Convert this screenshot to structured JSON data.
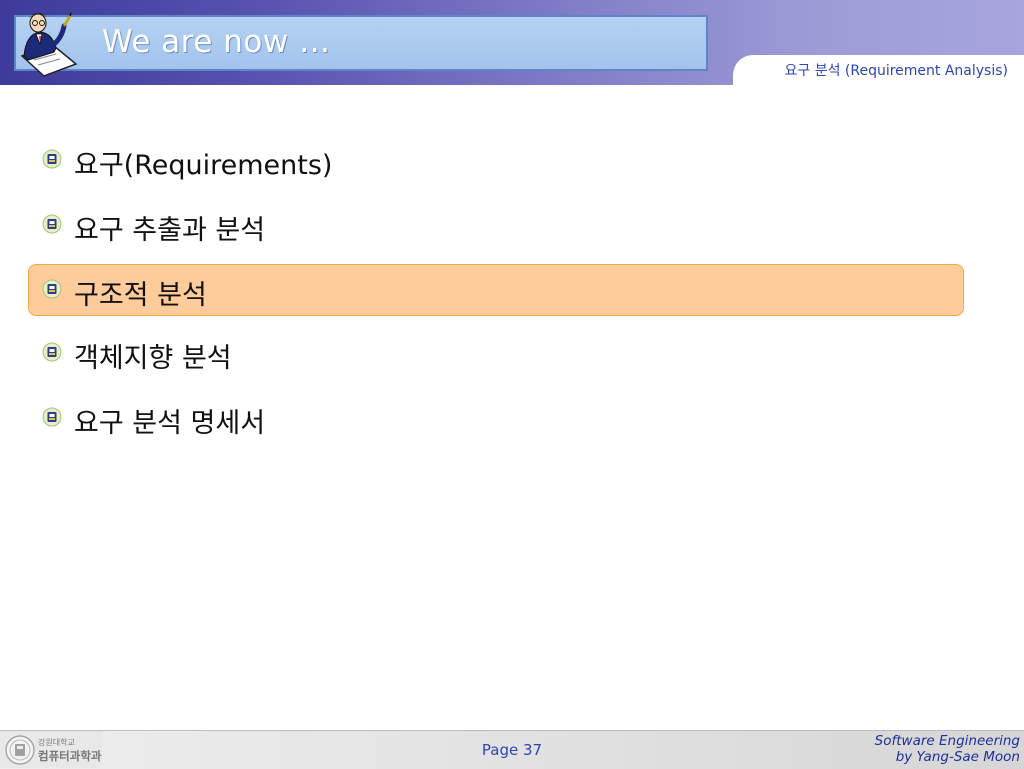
{
  "header": {
    "title": "We are now …",
    "section": "요구 분석 (Requirement Analysis)",
    "logo_icon": "teacher-writing-icon"
  },
  "bullets": [
    {
      "label": "요구(Requirements)",
      "highlighted": false
    },
    {
      "label": "요구 추출과 분석",
      "highlighted": false
    },
    {
      "label": "구조적 분석",
      "highlighted": true
    },
    {
      "label": "객체지향 분석",
      "highlighted": false
    },
    {
      "label": "요구 분석 명세서",
      "highlighted": false
    }
  ],
  "footer": {
    "university": "강원대학교",
    "department": "컴퓨터과학과",
    "page": "Page 37",
    "course": "Software Engineering",
    "author": "by Yang-Sae Moon"
  },
  "colors": {
    "header_start": "#3d3a9a",
    "header_end": "#a7a5dc",
    "title_box": "#a9c9ee",
    "highlight": "#fecc9a",
    "highlight_border": "#f0a94a",
    "accent_text": "#2d46b4"
  }
}
